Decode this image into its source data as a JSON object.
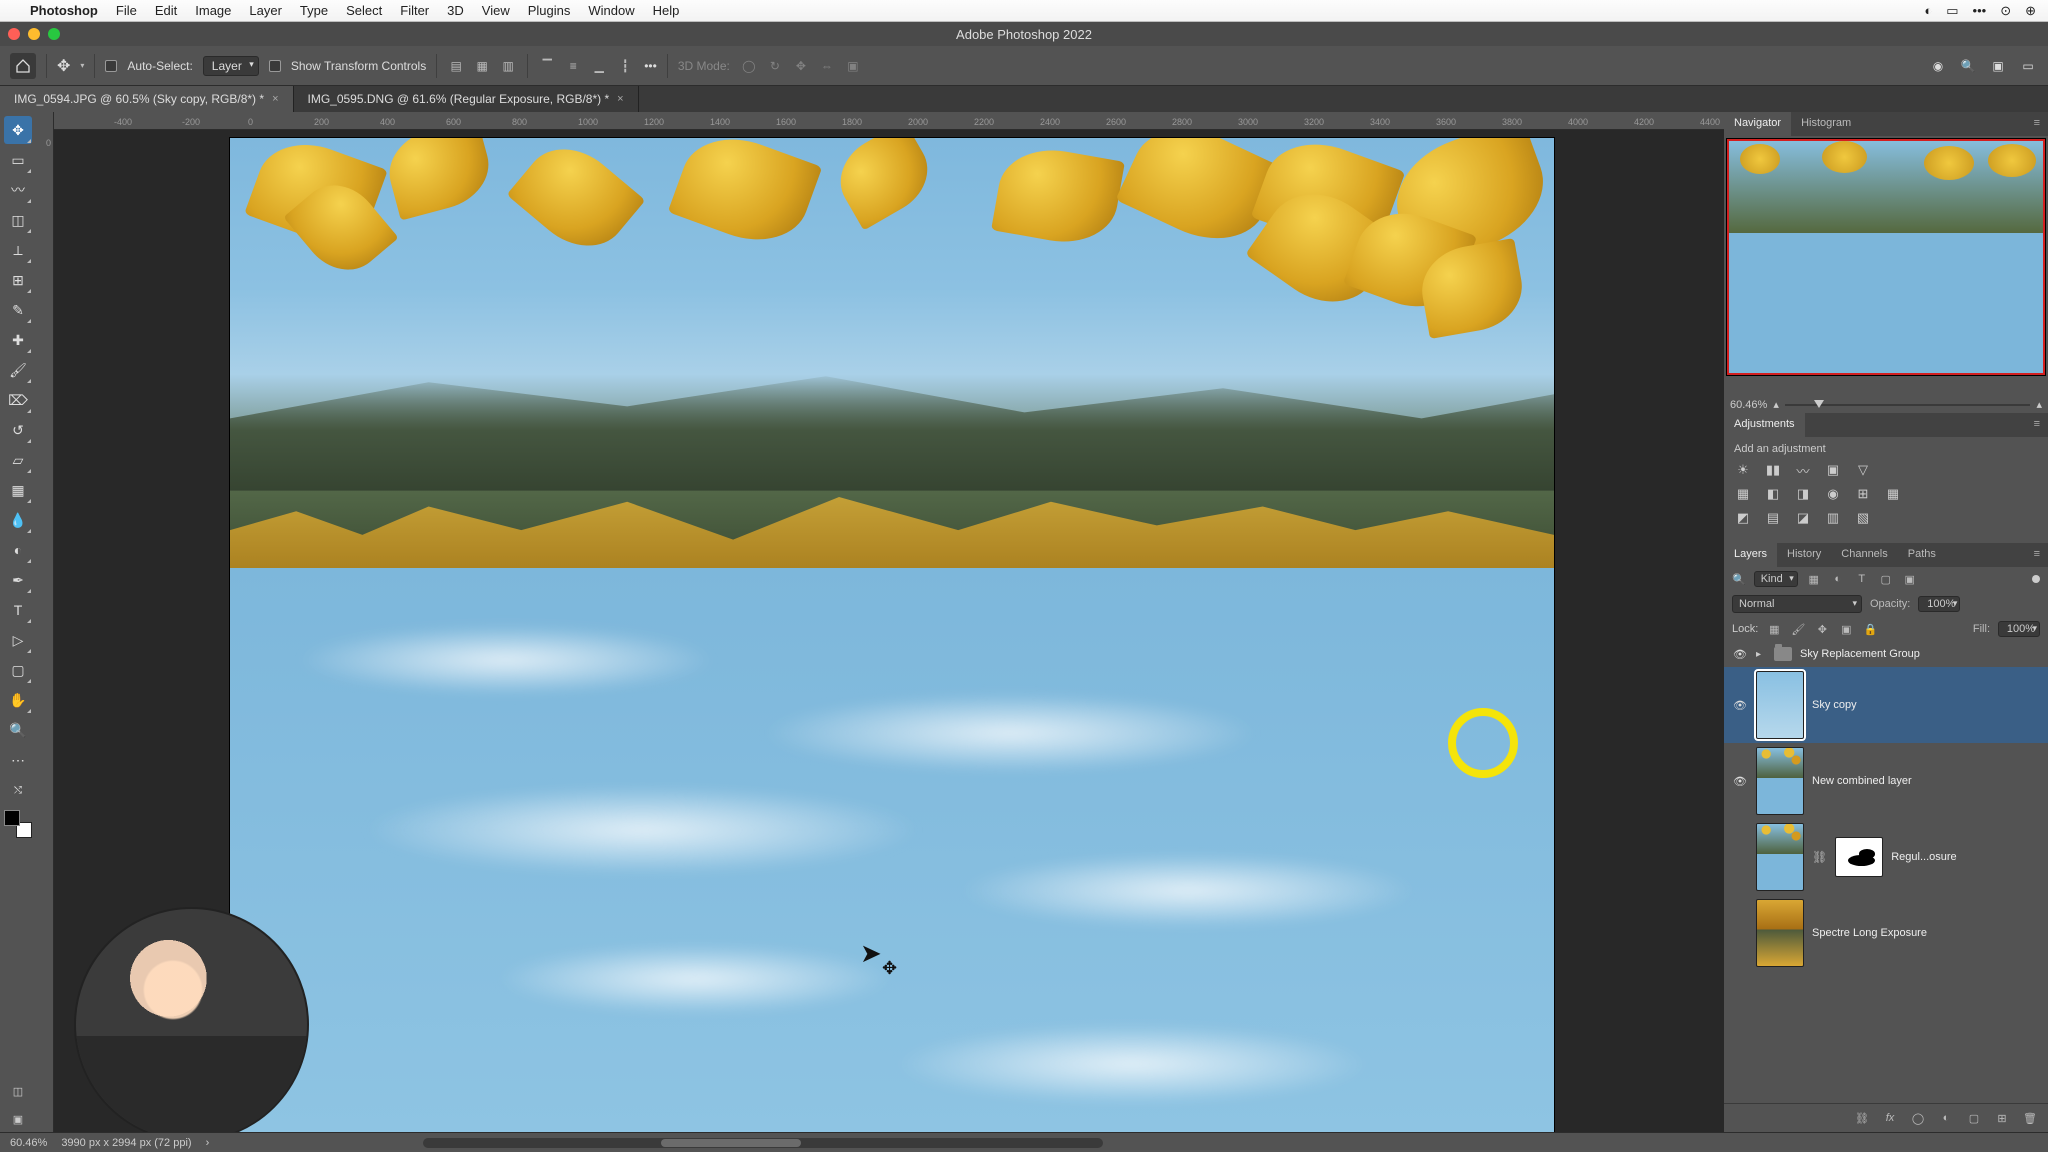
{
  "mac_menu": {
    "app_name": "Photoshop",
    "items": [
      "File",
      "Edit",
      "Image",
      "Layer",
      "Type",
      "Select",
      "Filter",
      "3D",
      "View",
      "Plugins",
      "Window",
      "Help"
    ]
  },
  "window": {
    "title": "Adobe Photoshop 2022"
  },
  "options_bar": {
    "auto_select_label": "Auto-Select:",
    "auto_select_value": "Layer",
    "show_transform": "Show Transform Controls",
    "mode_3d": "3D Mode:"
  },
  "tabs": [
    {
      "label": "IMG_0594.JPG @ 60.5% (Sky copy, RGB/8*) *",
      "active": true
    },
    {
      "label": "IMG_0595.DNG @ 61.6% (Regular Exposure, RGB/8*) *",
      "active": false
    }
  ],
  "ruler_ticks": [
    "-400",
    "-200",
    "0",
    "200",
    "400",
    "600",
    "800",
    "1000",
    "1200",
    "1400",
    "1600",
    "1800",
    "2000",
    "2200",
    "2400",
    "2600",
    "2800",
    "3000",
    "3200",
    "3400",
    "3600",
    "3800",
    "4000",
    "4200",
    "4400"
  ],
  "left_ruler_zero": "0",
  "navigator": {
    "tab1": "Navigator",
    "tab2": "Histogram",
    "zoom_readout": "60.46%"
  },
  "adjustments": {
    "title": "Adjustments",
    "subtitle": "Add an adjustment"
  },
  "layers_panel": {
    "tabs": [
      "Layers",
      "History",
      "Channels",
      "Paths"
    ],
    "filter_kind": "Kind",
    "blend_mode": "Normal",
    "opacity_label": "Opacity:",
    "opacity_value": "100%",
    "lock_label": "Lock:",
    "fill_label": "Fill:",
    "fill_value": "100%",
    "layers": [
      {
        "name": "Sky Replacement Group",
        "type": "group",
        "visible": true
      },
      {
        "name": "Sky copy",
        "type": "layer",
        "visible": true,
        "selected": true,
        "thumb": "sky"
      },
      {
        "name": "New combined layer",
        "type": "layer",
        "visible": true,
        "thumb": "scene"
      },
      {
        "name": "Regul...osure",
        "type": "masked",
        "visible": false,
        "thumb": "scene"
      },
      {
        "name": "Spectre Long Exposure",
        "type": "layer",
        "visible": false,
        "thumb": "autumn"
      }
    ]
  },
  "status": {
    "zoom": "60.46%",
    "doc_info": "3990 px x 2994 px (72 ppi)"
  }
}
